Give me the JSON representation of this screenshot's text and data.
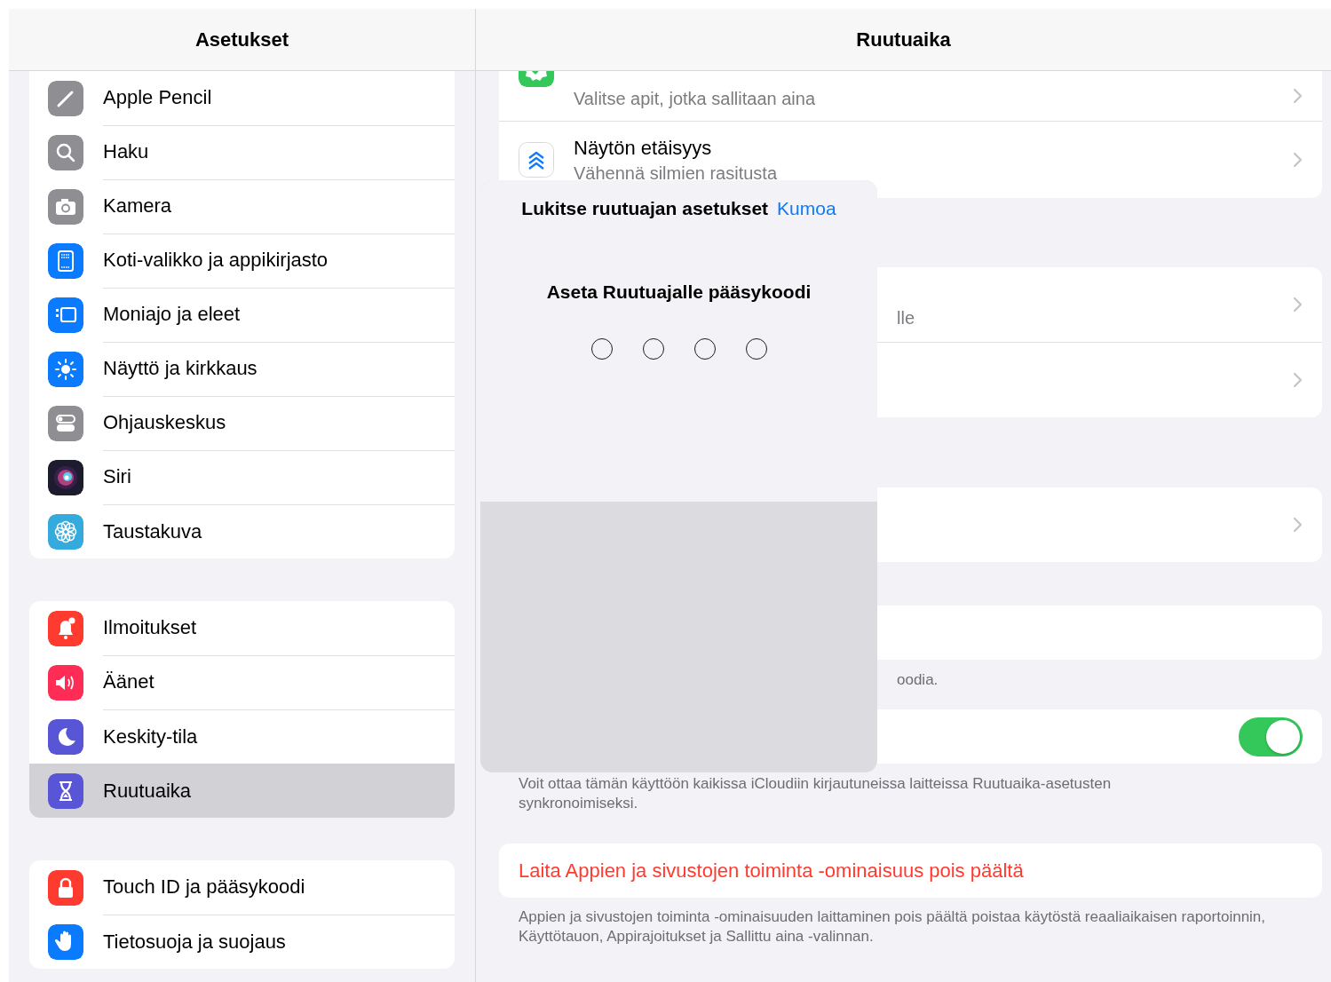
{
  "sidebar": {
    "title": "Asetukset",
    "groups": [
      {
        "items": [
          {
            "label": "Apple Pencil",
            "selected": false
          },
          {
            "label": "Haku",
            "selected": false
          },
          {
            "label": "Kamera",
            "selected": false
          },
          {
            "label": "Koti-valikko ja appikirjasto",
            "selected": false
          },
          {
            "label": "Moniajo ja eleet",
            "selected": false
          },
          {
            "label": "Näyttö ja kirkkaus",
            "selected": false
          },
          {
            "label": "Ohjauskeskus",
            "selected": false
          },
          {
            "label": "Siri",
            "selected": false
          },
          {
            "label": "Taustakuva",
            "selected": false
          }
        ]
      },
      {
        "items": [
          {
            "label": "Ilmoitukset",
            "selected": false
          },
          {
            "label": "Äänet",
            "selected": false
          },
          {
            "label": "Keskity-tila",
            "selected": false
          },
          {
            "label": "Ruutuaika",
            "selected": true
          }
        ]
      },
      {
        "items": [
          {
            "label": "Touch ID ja pääsykoodi",
            "selected": false
          },
          {
            "label": "Tietosuoja ja suojaus",
            "selected": false
          }
        ]
      }
    ]
  },
  "detail": {
    "title": "Ruutuaika",
    "top_rows": [
      {
        "subtitle": "Valitse apit, jotka sallitaan aina"
      },
      {
        "title": "Näytön etäisyys",
        "subtitle": "Vähennä silmien rasitusta"
      }
    ],
    "partial_row_text": "lle",
    "partial_footer": "oodia.",
    "sync_toggle": {
      "on": true
    },
    "sync_footer": "Voit ottaa tämän käyttöön kaikissa iCloudiin kirjautuneissa laitteissa Ruutuaika-asetusten synkronoimiseksi.",
    "disable_button": "Laita Appien ja sivustojen toiminta -ominaisuus pois päältä",
    "disable_footer": "Appien ja sivustojen toiminta -ominaisuuden laittaminen pois päältä poistaa käytöstä reaaliaikaisen raportoinnin, Käyttötauon, Appirajoitukset ja Sallittu aina -valinnan."
  },
  "passcode_sheet": {
    "title": "Lukitse ruutuajan asetukset",
    "cancel": "Kumoa",
    "prompt": "Aseta Ruutuajalle pääsykoodi",
    "digits": [
      {
        "filled": false
      },
      {
        "filled": false
      },
      {
        "filled": false
      },
      {
        "filled": false
      }
    ]
  }
}
